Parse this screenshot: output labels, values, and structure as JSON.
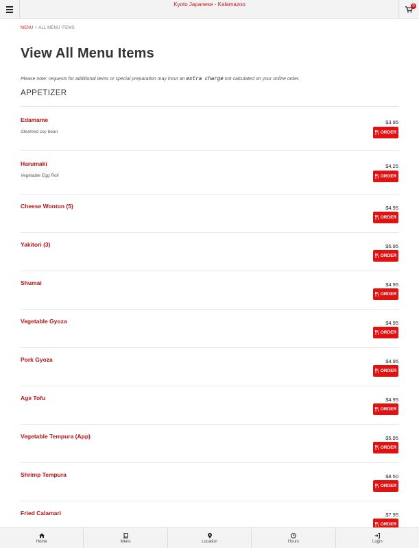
{
  "header": {
    "title": "Kyoto Japanese - Kalamazoo",
    "cart_count": "0",
    "menu_icon": "hamburger-icon",
    "cart_icon": "cart-icon"
  },
  "breadcrumb": {
    "menu": "MENU",
    "separator": ">",
    "current": "ALL MENU ITEMS"
  },
  "page_title": "View All Menu Items",
  "note": {
    "before": "Please note: requests for additional items or special preparation may incur an ",
    "highlight": "extra charge",
    "after": " not calculated on your online order."
  },
  "section": {
    "title": "APPETIZER"
  },
  "order_label": "ORDER",
  "items": [
    {
      "name": "Edamame",
      "description": "Steamed soy bean",
      "price": "$3.95"
    },
    {
      "name": "Harumaki",
      "description": "Vegetable Egg Roll",
      "price": "$4.25"
    },
    {
      "name": "Cheese Wonton (5)",
      "description": "",
      "price": "$4.95"
    },
    {
      "name": "Yakitori (3)",
      "description": "",
      "price": "$5.95"
    },
    {
      "name": "Shumai",
      "description": "",
      "price": "$4.95"
    },
    {
      "name": "Vegetable Gyoza",
      "description": "",
      "price": "$4.95"
    },
    {
      "name": "Pork Gyoza",
      "description": "",
      "price": "$4.95"
    },
    {
      "name": "Age Tofu",
      "description": "",
      "price": "$4.95"
    },
    {
      "name": "Vegetable Tempura (App)",
      "description": "",
      "price": "$5.95"
    },
    {
      "name": "Shrimp Tempura",
      "description": "",
      "price": "$8.50"
    },
    {
      "name": "Fried Calamari",
      "description": "",
      "price": "$7.95"
    }
  ],
  "bottom_nav": [
    {
      "label": "Home",
      "icon": "home-icon"
    },
    {
      "label": "Menu",
      "icon": "book-icon"
    },
    {
      "label": "Location",
      "icon": "map-pin-icon"
    },
    {
      "label": "Hours",
      "icon": "clock-icon"
    },
    {
      "label": "Login",
      "icon": "login-icon"
    }
  ],
  "colors": {
    "accent": "#c21818",
    "order_button": "#e31212",
    "bar_background": "#f3f3f3"
  }
}
